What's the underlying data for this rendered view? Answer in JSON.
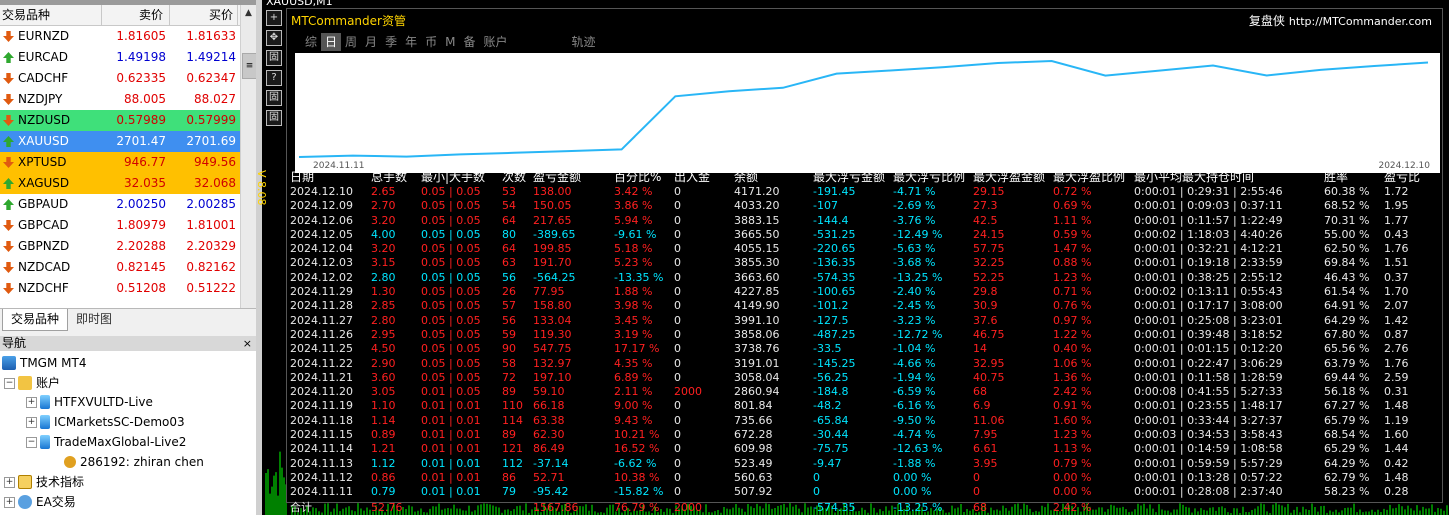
{
  "market_watch": {
    "header": {
      "symbol": "交易品种",
      "bid": "卖价",
      "ask": "买价"
    },
    "rows": [
      {
        "symbol": "EURNZD",
        "bid": "1.81605",
        "ask": "1.81633",
        "dir": "down",
        "hl": ""
      },
      {
        "symbol": "EURCAD",
        "bid": "1.49198",
        "ask": "1.49214",
        "dir": "up",
        "hl": ""
      },
      {
        "symbol": "CADCHF",
        "bid": "0.62335",
        "ask": "0.62347",
        "dir": "down",
        "hl": ""
      },
      {
        "symbol": "NZDJPY",
        "bid": "88.005",
        "ask": "88.027",
        "dir": "down",
        "hl": ""
      },
      {
        "symbol": "NZDUSD",
        "bid": "0.57989",
        "ask": "0.57999",
        "dir": "down",
        "hl": "green"
      },
      {
        "symbol": "XAUUSD",
        "bid": "2701.47",
        "ask": "2701.69",
        "dir": "up",
        "hl": "blue"
      },
      {
        "symbol": "XPTUSD",
        "bid": "946.77",
        "ask": "949.56",
        "dir": "down",
        "hl": "orange"
      },
      {
        "symbol": "XAGUSD",
        "bid": "32.035",
        "ask": "32.068",
        "dir": "up",
        "hl": "orange"
      },
      {
        "symbol": "GBPAUD",
        "bid": "2.00250",
        "ask": "2.00285",
        "dir": "up",
        "hl": ""
      },
      {
        "symbol": "GBPCAD",
        "bid": "1.80979",
        "ask": "1.81001",
        "dir": "down",
        "hl": ""
      },
      {
        "symbol": "GBPNZD",
        "bid": "2.20288",
        "ask": "2.20329",
        "dir": "down",
        "hl": ""
      },
      {
        "symbol": "NZDCAD",
        "bid": "0.82145",
        "ask": "0.82162",
        "dir": "down",
        "hl": ""
      },
      {
        "symbol": "NZDCHF",
        "bid": "0.51208",
        "ask": "0.51222",
        "dir": "down",
        "hl": ""
      }
    ],
    "tabs": [
      "交易品种",
      "即时图"
    ]
  },
  "navigator": {
    "title": "导航",
    "close": "×",
    "items": {
      "terminal": "TMGM MT4",
      "accounts": "账户",
      "acct1": "HTFXVULTD-Live",
      "acct2": "ICMarketsSC-Demo03",
      "acct3": "TradeMaxGlobal-Live2",
      "user": "286192: zhiran chen",
      "indicators": "技术指标",
      "ea": "EA交易"
    }
  },
  "chart": {
    "window_title": "XAUUSD,M1",
    "price_axis_label": "V 8.08",
    "toolbar": [
      "+",
      "✥",
      "固",
      "?",
      "固",
      "固"
    ]
  },
  "panel": {
    "title": "MTCommander资管",
    "brand": "复盘侠",
    "url": "http://MTCommander.com",
    "tabs": [
      "综",
      "日",
      "周",
      "月",
      "季",
      "年",
      "币",
      "M",
      "备",
      "账户",
      "轨迹"
    ],
    "active_tab": "日",
    "equity": {
      "start_date": "2024.11.11",
      "end_date": "2024.12.10",
      "line_color": "#29b6f6"
    },
    "table": {
      "headers": [
        "日期",
        "总手数",
        "最小|大手数",
        "次数",
        "盈亏金额",
        "百分比%",
        "出入金",
        "余额",
        "最大浮亏金额",
        "最大浮亏比例",
        "最大浮盈金额",
        "最大浮盈比例",
        "最小平均最大持仓时间",
        "胜率",
        "盈亏比"
      ],
      "rows": [
        [
          "2024.12.10",
          "2.65",
          "0.05 | 0.05",
          "53",
          "138.00",
          "3.42 %",
          "0",
          "4171.20",
          "-191.45",
          "-4.71 %",
          "29.15",
          "0.72 %",
          "0:00:01 | 0:29:31 | 2:55:46",
          "60.38 %",
          "1.72"
        ],
        [
          "2024.12.09",
          "2.70",
          "0.05 | 0.05",
          "54",
          "150.05",
          "3.86 %",
          "0",
          "4033.20",
          "-107",
          "-2.69 %",
          "27.3",
          "0.69 %",
          "0:00:01 | 0:09:03 | 0:37:11",
          "68.52 %",
          "1.95"
        ],
        [
          "2024.12.06",
          "3.20",
          "0.05 | 0.05",
          "64",
          "217.65",
          "5.94 %",
          "0",
          "3883.15",
          "-144.4",
          "-3.76 %",
          "42.5",
          "1.11 %",
          "0:00:01 | 0:11:57 | 1:22:49",
          "70.31 %",
          "1.77"
        ],
        [
          "2024.12.05",
          "4.00",
          "0.05 | 0.05",
          "80",
          "-389.65",
          "-9.61 %",
          "0",
          "3665.50",
          "-531.25",
          "-12.49 %",
          "24.15",
          "0.59 %",
          "0:00:02 | 1:18:03 | 4:40:26",
          "55.00 %",
          "0.43"
        ],
        [
          "2024.12.04",
          "3.20",
          "0.05 | 0.05",
          "64",
          "199.85",
          "5.18 %",
          "0",
          "4055.15",
          "-220.65",
          "-5.63 %",
          "57.75",
          "1.47 %",
          "0:00:01 | 0:32:21 | 4:12:21",
          "62.50 %",
          "1.76"
        ],
        [
          "2024.12.03",
          "3.15",
          "0.05 | 0.05",
          "63",
          "191.70",
          "5.23 %",
          "0",
          "3855.30",
          "-136.35",
          "-3.68 %",
          "32.25",
          "0.88 %",
          "0:00:01 | 0:19:18 | 2:33:59",
          "69.84 %",
          "1.51"
        ],
        [
          "2024.12.02",
          "2.80",
          "0.05 | 0.05",
          "56",
          "-564.25",
          "-13.35 %",
          "0",
          "3663.60",
          "-574.35",
          "-13.25 %",
          "52.25",
          "1.23 %",
          "0:00:01 | 0:38:25 | 2:55:12",
          "46.43 %",
          "0.37"
        ],
        [
          "2024.11.29",
          "1.30",
          "0.05 | 0.05",
          "26",
          "77.95",
          "1.88 %",
          "0",
          "4227.85",
          "-100.65",
          "-2.40 %",
          "29.8",
          "0.71 %",
          "0:00:02 | 0:13:11 | 0:55:43",
          "61.54 %",
          "1.70"
        ],
        [
          "2024.11.28",
          "2.85",
          "0.05 | 0.05",
          "57",
          "158.80",
          "3.98 %",
          "0",
          "4149.90",
          "-101.2",
          "-2.45 %",
          "30.9",
          "0.76 %",
          "0:00:01 | 0:17:17 | 3:08:00",
          "64.91 %",
          "2.07"
        ],
        [
          "2024.11.27",
          "2.80",
          "0.05 | 0.05",
          "56",
          "133.04",
          "3.45 %",
          "0",
          "3991.10",
          "-127.5",
          "-3.23 %",
          "37.6",
          "0.97 %",
          "0:00:01 | 0:25:08 | 3:23:01",
          "64.29 %",
          "1.42"
        ],
        [
          "2024.11.26",
          "2.95",
          "0.05 | 0.05",
          "59",
          "119.30",
          "3.19 %",
          "0",
          "3858.06",
          "-487.25",
          "-12.72 %",
          "46.75",
          "1.22 %",
          "0:00:01 | 0:39:48 | 3:18:52",
          "67.80 %",
          "0.87"
        ],
        [
          "2024.11.25",
          "4.50",
          "0.05 | 0.05",
          "90",
          "547.75",
          "17.17 %",
          "0",
          "3738.76",
          "-33.5",
          "-1.04 %",
          "14",
          "0.40 %",
          "0:00:01 | 0:01:15 | 0:12:20",
          "65.56 %",
          "2.76"
        ],
        [
          "2024.11.22",
          "2.90",
          "0.05 | 0.05",
          "58",
          "132.97",
          "4.35 %",
          "0",
          "3191.01",
          "-145.25",
          "-4.66 %",
          "32.95",
          "1.06 %",
          "0:00:01 | 0:22:47 | 3:06:29",
          "63.79 %",
          "1.76"
        ],
        [
          "2024.11.21",
          "3.60",
          "0.05 | 0.05",
          "72",
          "197.10",
          "6.89 %",
          "0",
          "3058.04",
          "-56.25",
          "-1.94 %",
          "40.75",
          "1.36 %",
          "0:00:01 | 0:11:58 | 1:28:59",
          "69.44 %",
          "2.59"
        ],
        [
          "2024.11.20",
          "3.05",
          "0.01 | 0.05",
          "89",
          "59.10",
          "2.11 %",
          "2000",
          "2860.94",
          "-184.8",
          "-6.59 %",
          "68",
          "2.42 %",
          "0:00:08 | 0:41:55 | 5:27:33",
          "56.18 %",
          "0.31"
        ],
        [
          "2024.11.19",
          "1.10",
          "0.01 | 0.01",
          "110",
          "66.18",
          "9.00 %",
          "0",
          "801.84",
          "-48.2",
          "-6.16 %",
          "6.9",
          "0.91 %",
          "0:00:01 | 0:23:55 | 1:48:17",
          "67.27 %",
          "1.48"
        ],
        [
          "2024.11.18",
          "1.14",
          "0.01 | 0.01",
          "114",
          "63.38",
          "9.43 %",
          "0",
          "735.66",
          "-65.84",
          "-9.50 %",
          "11.06",
          "1.60 %",
          "0:00:01 | 0:33:44 | 3:27:37",
          "65.79 %",
          "1.19"
        ],
        [
          "2024.11.15",
          "0.89",
          "0.01 | 0.01",
          "89",
          "62.30",
          "10.21 %",
          "0",
          "672.28",
          "-30.44",
          "-4.74 %",
          "7.95",
          "1.23 %",
          "0:00:03 | 0:34:53 | 3:58:43",
          "68.54 %",
          "1.60"
        ],
        [
          "2024.11.14",
          "1.21",
          "0.01 | 0.01",
          "121",
          "86.49",
          "16.52 %",
          "0",
          "609.98",
          "-75.75",
          "-12.63 %",
          "6.61",
          "1.13 %",
          "0:00:01 | 0:14:59 | 1:08:58",
          "65.29 %",
          "1.44"
        ],
        [
          "2024.11.13",
          "1.12",
          "0.01 | 0.01",
          "112",
          "-37.14",
          "-6.62 %",
          "0",
          "523.49",
          "-9.47",
          "-1.88 %",
          "3.95",
          "0.79 %",
          "0:00:01 | 0:59:59 | 5:57:29",
          "64.29 %",
          "0.42"
        ],
        [
          "2024.11.12",
          "0.86",
          "0.01 | 0.01",
          "86",
          "52.71",
          "10.38 %",
          "0",
          "560.63",
          "0",
          "0.00 %",
          "0",
          "0.00 %",
          "0:00:01 | 0:13:28 | 0:57:22",
          "62.79 %",
          "1.48"
        ],
        [
          "2024.11.11",
          "0.79",
          "0.01 | 0.01",
          "79",
          "-95.42",
          "-15.82 %",
          "0",
          "507.92",
          "0",
          "0.00 %",
          "0",
          "0.00 %",
          "0:00:01 | 0:28:08 | 2:37:40",
          "58.23 %",
          "0.28"
        ]
      ],
      "total": [
        "合计",
        "52.76",
        "",
        "",
        "1567.86",
        "76.79 %",
        "2000",
        "",
        "-574.35",
        "-13.25 %",
        "68",
        "2.42 %",
        "",
        "",
        ""
      ]
    }
  },
  "colors": {
    "positive": "#ff2020",
    "negative": "#00e5ff",
    "panel_title": "#ffd400"
  }
}
